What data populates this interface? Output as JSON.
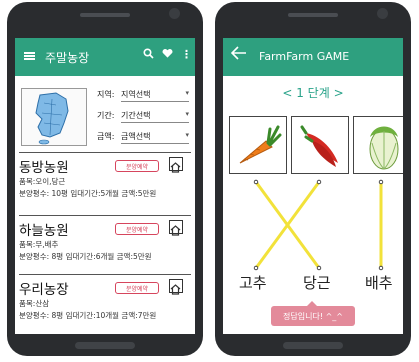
{
  "left_app": {
    "title": "주말농장",
    "filters": [
      {
        "label": "지역:",
        "value": "지역선택"
      },
      {
        "label": "기간:",
        "value": "기간선택"
      },
      {
        "label": "금액:",
        "value": "금액선택"
      }
    ],
    "reserve_label": "분양예약",
    "farms": [
      {
        "name": "동방농원",
        "items": "품목:오이,당근",
        "details": "분양평수: 10평 임대기간:5개월 금액:5만원"
      },
      {
        "name": "하늘농원",
        "items": "품목:무,배추",
        "details": "분양평수: 8평 임대기간:6개월 금액:5만원"
      },
      {
        "name": "우리농장",
        "items": "품목:산삼",
        "details": "분양평수: 8평 임대기간:10개월 금액:7만원"
      }
    ]
  },
  "right_app": {
    "title": "FarmFarm GAME",
    "stage": "< 1 단계 >",
    "pictures": [
      "carrot-icon",
      "red-pepper-icon",
      "cabbage-icon"
    ],
    "words": [
      "고추",
      "당근",
      "배추"
    ],
    "result": "정답입니다! ^_^"
  },
  "colors": {
    "accent": "#2ea07f",
    "line": "#f2e23a",
    "reserve": "#d6455d",
    "toast": "#e38a9a"
  }
}
